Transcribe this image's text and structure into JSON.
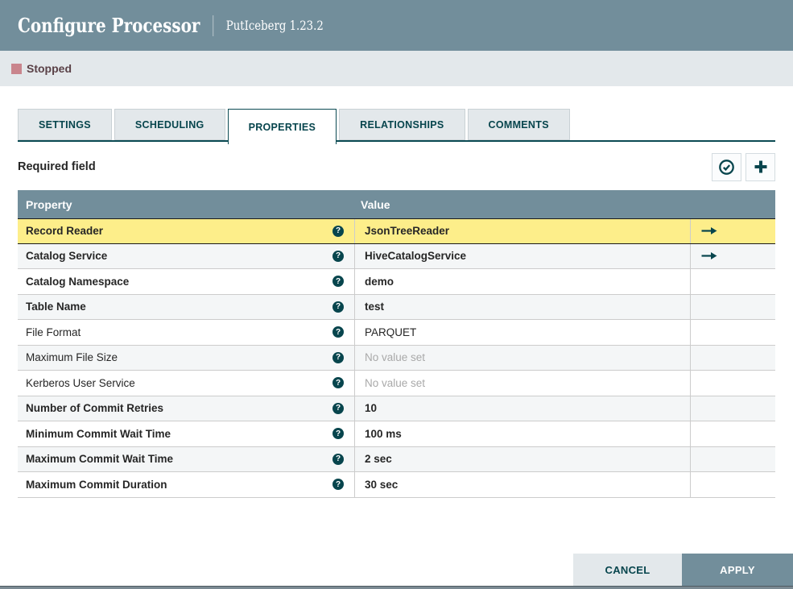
{
  "header": {
    "title": "Configure Processor",
    "subtitle": "PutIceberg 1.23.2"
  },
  "status": {
    "label": "Stopped",
    "color": "#c9858d"
  },
  "tabs": [
    {
      "label": "SETTINGS",
      "active": false
    },
    {
      "label": "SCHEDULING",
      "active": false
    },
    {
      "label": "PROPERTIES",
      "active": true
    },
    {
      "label": "RELATIONSHIPS",
      "active": false
    },
    {
      "label": "COMMENTS",
      "active": false
    }
  ],
  "toolbar": {
    "hint": "Required field",
    "buttons": [
      "verify-properties",
      "add-property"
    ]
  },
  "table": {
    "columns": {
      "property": "Property",
      "value": "Value"
    },
    "rows": [
      {
        "name": "Record Reader",
        "value": "JsonTreeReader",
        "bold": true,
        "empty": false,
        "arrow": true,
        "selected": true,
        "striped": false
      },
      {
        "name": "Catalog Service",
        "value": "HiveCatalogService",
        "bold": true,
        "empty": false,
        "arrow": true,
        "selected": false,
        "striped": true
      },
      {
        "name": "Catalog Namespace",
        "value": "demo",
        "bold": true,
        "empty": false,
        "arrow": false,
        "selected": false,
        "striped": false
      },
      {
        "name": "Table Name",
        "value": "test",
        "bold": true,
        "empty": false,
        "arrow": false,
        "selected": false,
        "striped": true
      },
      {
        "name": "File Format",
        "value": "PARQUET",
        "bold": false,
        "empty": false,
        "arrow": false,
        "selected": false,
        "striped": false
      },
      {
        "name": "Maximum File Size",
        "value": "No value set",
        "bold": false,
        "empty": true,
        "arrow": false,
        "selected": false,
        "striped": true
      },
      {
        "name": "Kerberos User Service",
        "value": "No value set",
        "bold": false,
        "empty": true,
        "arrow": false,
        "selected": false,
        "striped": false
      },
      {
        "name": "Number of Commit Retries",
        "value": "10",
        "bold": true,
        "empty": false,
        "arrow": false,
        "selected": false,
        "striped": true
      },
      {
        "name": "Minimum Commit Wait Time",
        "value": "100 ms",
        "bold": true,
        "empty": false,
        "arrow": false,
        "selected": false,
        "striped": false
      },
      {
        "name": "Maximum Commit Wait Time",
        "value": "2 sec",
        "bold": true,
        "empty": false,
        "arrow": false,
        "selected": false,
        "striped": true
      },
      {
        "name": "Maximum Commit Duration",
        "value": "30 sec",
        "bold": true,
        "empty": false,
        "arrow": false,
        "selected": false,
        "striped": false
      }
    ]
  },
  "footer": {
    "cancel": "CANCEL",
    "apply": "APPLY"
  },
  "colors": {
    "accent": "#07454d",
    "header": "#728e9b",
    "selected_row": "#fdee8a",
    "stripe": "#f4f6f7"
  }
}
